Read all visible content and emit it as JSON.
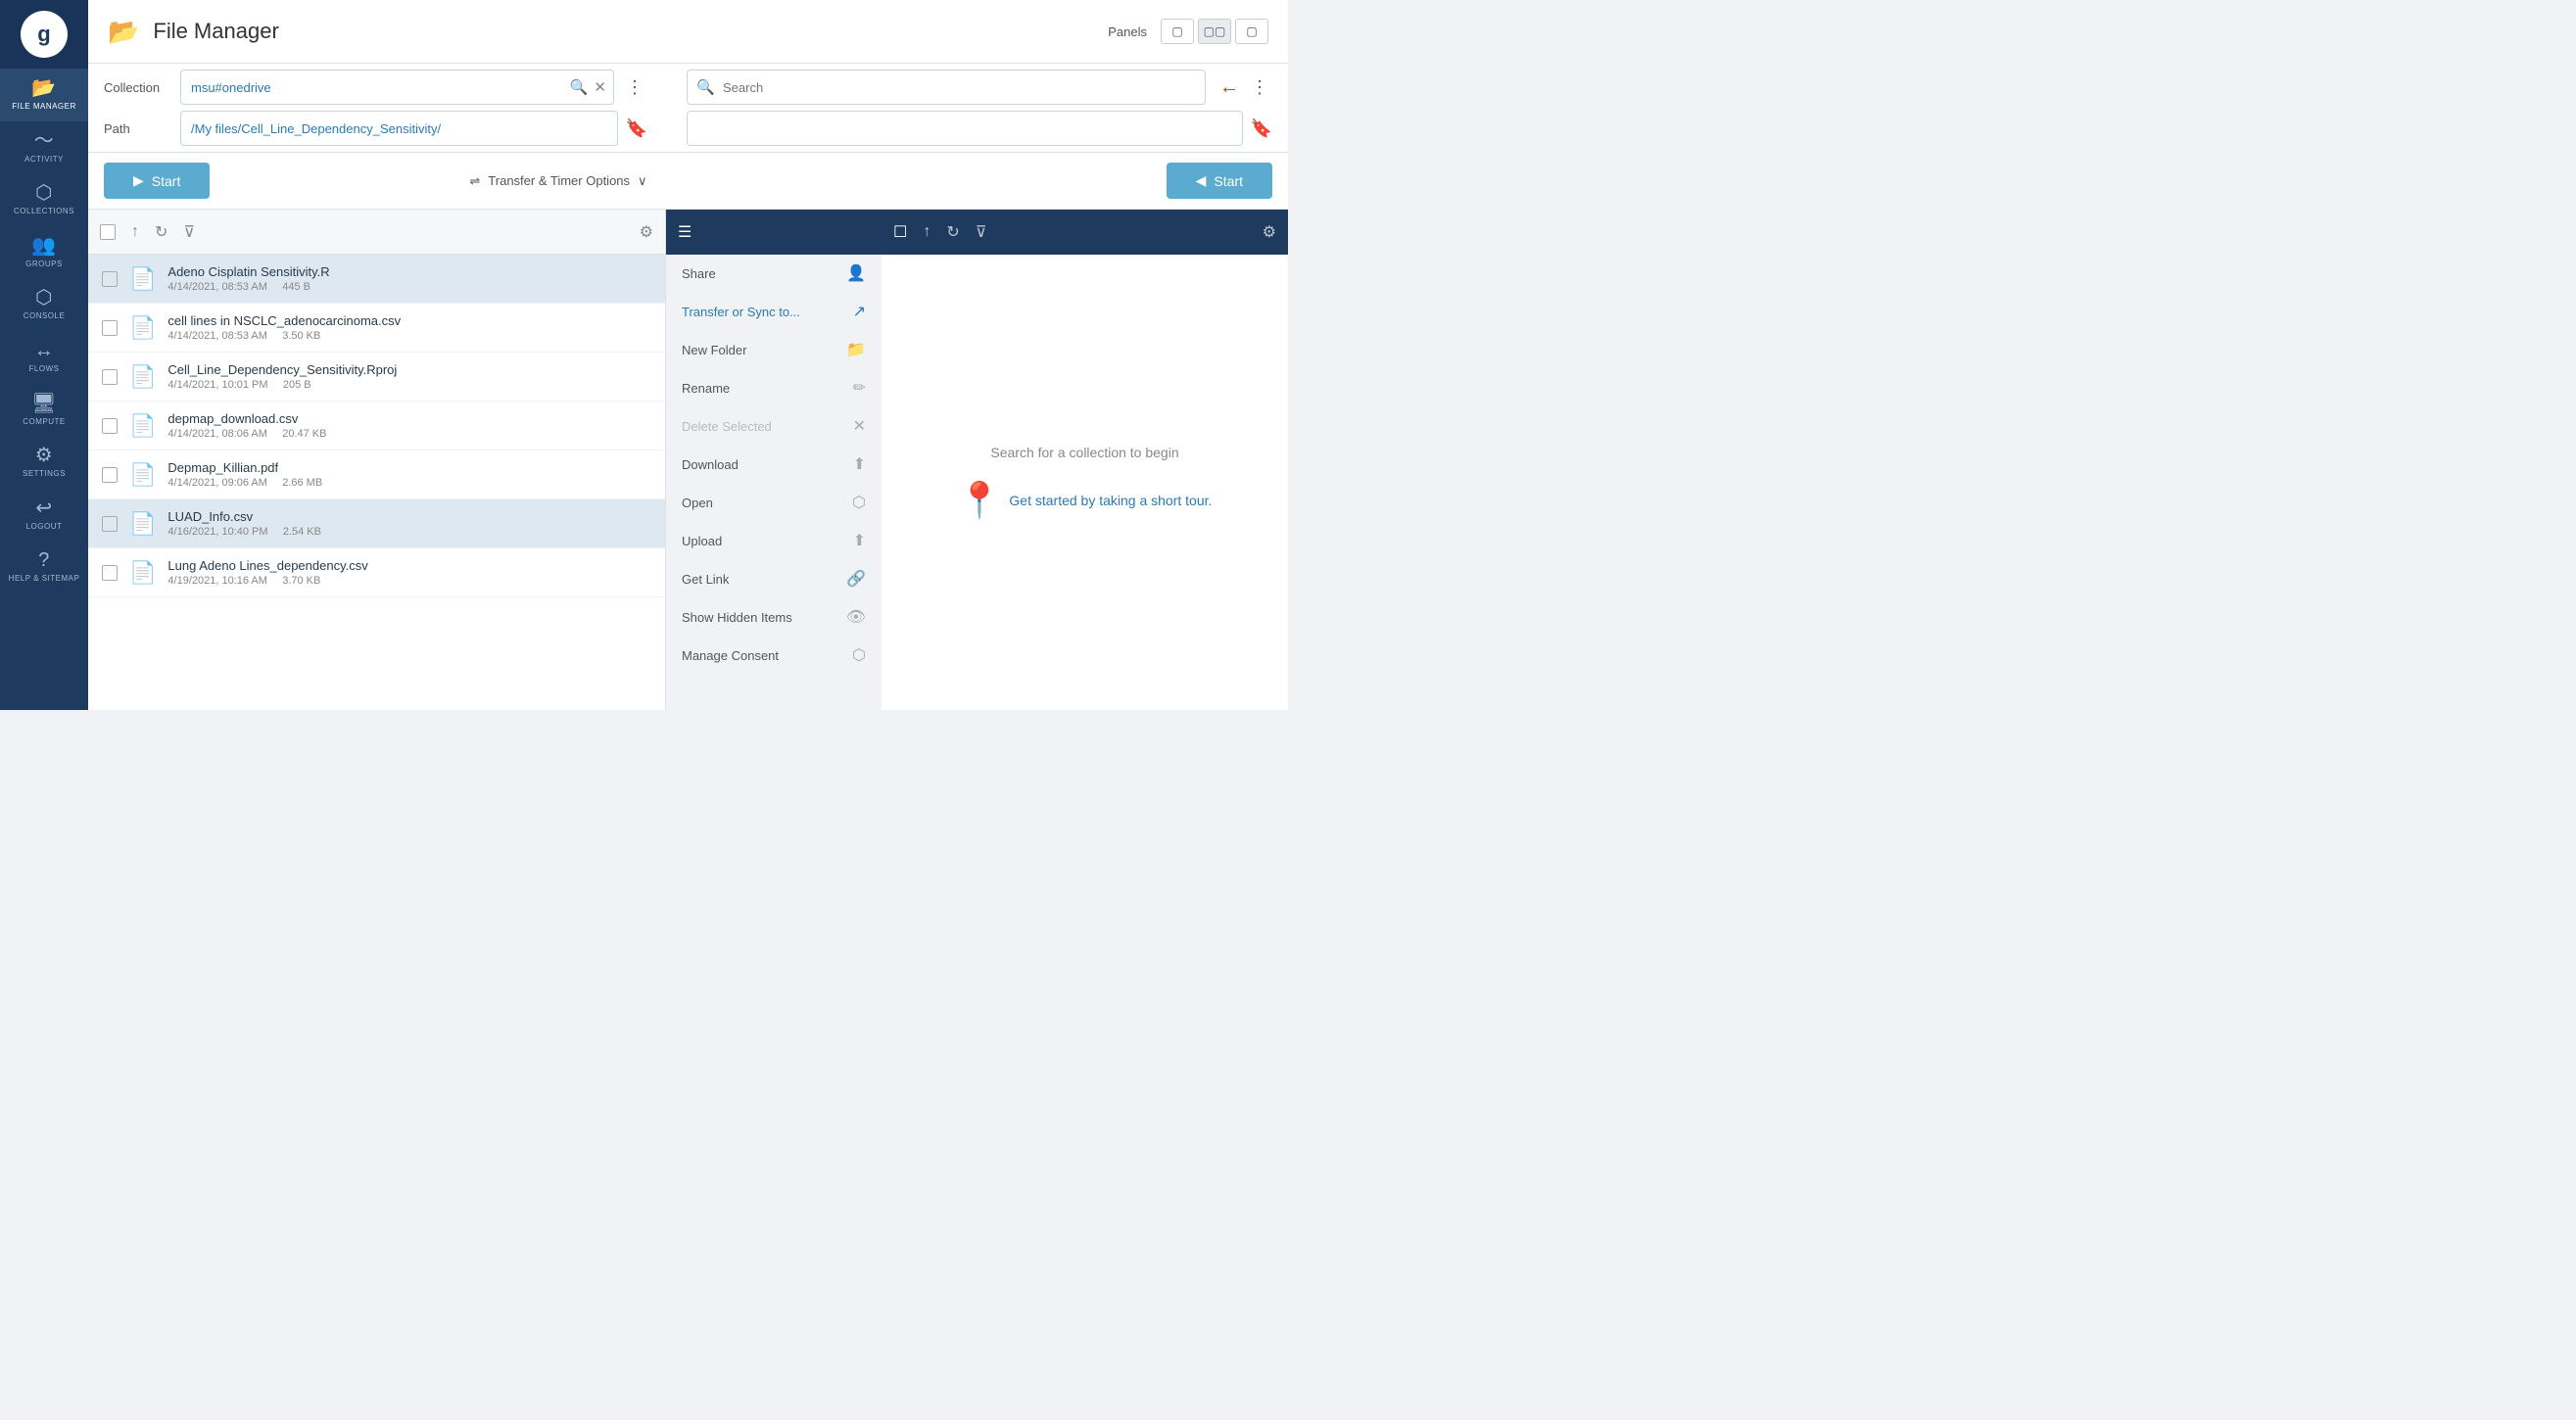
{
  "app": {
    "title": "File Manager",
    "logo": "g"
  },
  "panels_label": "Panels",
  "sidebar": {
    "items": [
      {
        "id": "file-manager",
        "label": "FILE MANAGER",
        "icon": "📁",
        "active": true
      },
      {
        "id": "activity",
        "label": "ACTIVITY",
        "icon": "📈",
        "active": false
      },
      {
        "id": "collections",
        "label": "COLLECTIONS",
        "icon": "⬡",
        "active": false
      },
      {
        "id": "groups",
        "label": "GROUPS",
        "icon": "👥",
        "active": false
      },
      {
        "id": "console",
        "label": "CONSOLE",
        "icon": "⚙",
        "active": false
      },
      {
        "id": "flows",
        "label": "FLOWS",
        "icon": "↔",
        "active": false
      },
      {
        "id": "compute",
        "label": "COMPUTE",
        "icon": "🖥",
        "active": false
      },
      {
        "id": "settings",
        "label": "SETTINGS",
        "icon": "⚙",
        "active": false
      },
      {
        "id": "logout",
        "label": "LOGOUT",
        "icon": "⬡",
        "active": false
      },
      {
        "id": "help",
        "label": "HELP & SITEMAP",
        "icon": "?",
        "active": false
      }
    ]
  },
  "left_panel": {
    "collection_label": "Collection",
    "collection_value": "msu#onedrive",
    "path_label": "Path",
    "path_value": "/My files/Cell_Line_Dependency_Sensitivity/",
    "start_label": "Start",
    "transfer_options_label": "Transfer & Timer Options",
    "files": [
      {
        "name": "Adeno Cisplatin Sensitivity.R",
        "date": "4/14/2021, 08:53 AM",
        "size": "445 B",
        "selected": true
      },
      {
        "name": "cell lines in NSCLC_adenocarcinoma.csv",
        "date": "4/14/2021, 08:53 AM",
        "size": "3.50 KB",
        "selected": false
      },
      {
        "name": "Cell_Line_Dependency_Sensitivity.Rproj",
        "date": "4/14/2021, 10:01 PM",
        "size": "205 B",
        "selected": false
      },
      {
        "name": "depmap_download.csv",
        "date": "4/14/2021, 08:06 AM",
        "size": "20.47 KB",
        "selected": false
      },
      {
        "name": "Depmap_Killian.pdf",
        "date": "4/14/2021, 09:06 AM",
        "size": "2.66 MB",
        "selected": false
      },
      {
        "name": "LUAD_Info.csv",
        "date": "4/16/2021, 10:40 PM",
        "size": "2.54 KB",
        "selected": true
      },
      {
        "name": "Lung Adeno Lines_dependency.csv",
        "date": "4/19/2021, 10:16 AM",
        "size": "3.70 KB",
        "selected": false
      }
    ]
  },
  "context_menu": {
    "items": [
      {
        "id": "share",
        "label": "Share",
        "icon": "👤",
        "highlight": false,
        "disabled": false
      },
      {
        "id": "transfer-or-sync",
        "label": "Transfer or Sync to...",
        "icon": "↗",
        "highlight": true,
        "disabled": false
      },
      {
        "id": "new-folder",
        "label": "New Folder",
        "icon": "📁",
        "highlight": false,
        "disabled": false
      },
      {
        "id": "rename",
        "label": "Rename",
        "icon": "✏",
        "highlight": false,
        "disabled": false
      },
      {
        "id": "delete-selected",
        "label": "Delete Selected",
        "icon": "✕",
        "highlight": false,
        "disabled": false
      },
      {
        "id": "download",
        "label": "Download",
        "icon": "⬆",
        "highlight": false,
        "disabled": false
      },
      {
        "id": "open",
        "label": "Open",
        "icon": "⬡",
        "highlight": false,
        "disabled": false
      },
      {
        "id": "upload",
        "label": "Upload",
        "icon": "⬆",
        "highlight": false,
        "disabled": false
      },
      {
        "id": "get-link",
        "label": "Get Link",
        "icon": "🔗",
        "highlight": false,
        "disabled": false
      },
      {
        "id": "show-hidden",
        "label": "Show Hidden Items",
        "icon": "👁",
        "highlight": false,
        "disabled": false
      },
      {
        "id": "manage-consent",
        "label": "Manage Consent",
        "icon": "⬡",
        "highlight": false,
        "disabled": false
      }
    ]
  },
  "right_panel": {
    "search_placeholder": "Search",
    "start_label": "Start",
    "empty_text": "Search for a collection to begin",
    "tour_text": "Get started by taking a short tour."
  }
}
